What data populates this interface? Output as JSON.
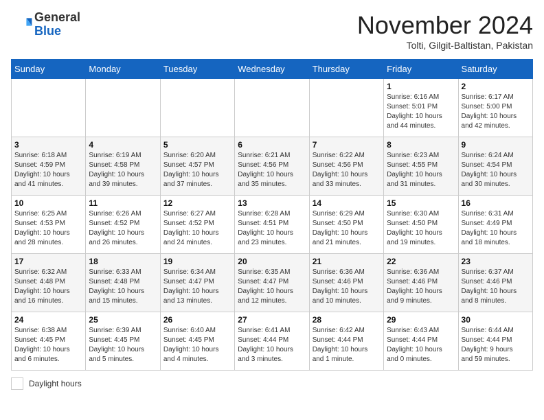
{
  "header": {
    "logo_general": "General",
    "logo_blue": "Blue",
    "month_title": "November 2024",
    "location": "Tolti, Gilgit-Baltistan, Pakistan"
  },
  "days_of_week": [
    "Sunday",
    "Monday",
    "Tuesday",
    "Wednesday",
    "Thursday",
    "Friday",
    "Saturday"
  ],
  "weeks": [
    [
      {
        "day": "",
        "info": ""
      },
      {
        "day": "",
        "info": ""
      },
      {
        "day": "",
        "info": ""
      },
      {
        "day": "",
        "info": ""
      },
      {
        "day": "",
        "info": ""
      },
      {
        "day": "1",
        "info": "Sunrise: 6:16 AM\nSunset: 5:01 PM\nDaylight: 10 hours\nand 44 minutes."
      },
      {
        "day": "2",
        "info": "Sunrise: 6:17 AM\nSunset: 5:00 PM\nDaylight: 10 hours\nand 42 minutes."
      }
    ],
    [
      {
        "day": "3",
        "info": "Sunrise: 6:18 AM\nSunset: 4:59 PM\nDaylight: 10 hours\nand 41 minutes."
      },
      {
        "day": "4",
        "info": "Sunrise: 6:19 AM\nSunset: 4:58 PM\nDaylight: 10 hours\nand 39 minutes."
      },
      {
        "day": "5",
        "info": "Sunrise: 6:20 AM\nSunset: 4:57 PM\nDaylight: 10 hours\nand 37 minutes."
      },
      {
        "day": "6",
        "info": "Sunrise: 6:21 AM\nSunset: 4:56 PM\nDaylight: 10 hours\nand 35 minutes."
      },
      {
        "day": "7",
        "info": "Sunrise: 6:22 AM\nSunset: 4:56 PM\nDaylight: 10 hours\nand 33 minutes."
      },
      {
        "day": "8",
        "info": "Sunrise: 6:23 AM\nSunset: 4:55 PM\nDaylight: 10 hours\nand 31 minutes."
      },
      {
        "day": "9",
        "info": "Sunrise: 6:24 AM\nSunset: 4:54 PM\nDaylight: 10 hours\nand 30 minutes."
      }
    ],
    [
      {
        "day": "10",
        "info": "Sunrise: 6:25 AM\nSunset: 4:53 PM\nDaylight: 10 hours\nand 28 minutes."
      },
      {
        "day": "11",
        "info": "Sunrise: 6:26 AM\nSunset: 4:52 PM\nDaylight: 10 hours\nand 26 minutes."
      },
      {
        "day": "12",
        "info": "Sunrise: 6:27 AM\nSunset: 4:52 PM\nDaylight: 10 hours\nand 24 minutes."
      },
      {
        "day": "13",
        "info": "Sunrise: 6:28 AM\nSunset: 4:51 PM\nDaylight: 10 hours\nand 23 minutes."
      },
      {
        "day": "14",
        "info": "Sunrise: 6:29 AM\nSunset: 4:50 PM\nDaylight: 10 hours\nand 21 minutes."
      },
      {
        "day": "15",
        "info": "Sunrise: 6:30 AM\nSunset: 4:50 PM\nDaylight: 10 hours\nand 19 minutes."
      },
      {
        "day": "16",
        "info": "Sunrise: 6:31 AM\nSunset: 4:49 PM\nDaylight: 10 hours\nand 18 minutes."
      }
    ],
    [
      {
        "day": "17",
        "info": "Sunrise: 6:32 AM\nSunset: 4:48 PM\nDaylight: 10 hours\nand 16 minutes."
      },
      {
        "day": "18",
        "info": "Sunrise: 6:33 AM\nSunset: 4:48 PM\nDaylight: 10 hours\nand 15 minutes."
      },
      {
        "day": "19",
        "info": "Sunrise: 6:34 AM\nSunset: 4:47 PM\nDaylight: 10 hours\nand 13 minutes."
      },
      {
        "day": "20",
        "info": "Sunrise: 6:35 AM\nSunset: 4:47 PM\nDaylight: 10 hours\nand 12 minutes."
      },
      {
        "day": "21",
        "info": "Sunrise: 6:36 AM\nSunset: 4:46 PM\nDaylight: 10 hours\nand 10 minutes."
      },
      {
        "day": "22",
        "info": "Sunrise: 6:36 AM\nSunset: 4:46 PM\nDaylight: 10 hours\nand 9 minutes."
      },
      {
        "day": "23",
        "info": "Sunrise: 6:37 AM\nSunset: 4:46 PM\nDaylight: 10 hours\nand 8 minutes."
      }
    ],
    [
      {
        "day": "24",
        "info": "Sunrise: 6:38 AM\nSunset: 4:45 PM\nDaylight: 10 hours\nand 6 minutes."
      },
      {
        "day": "25",
        "info": "Sunrise: 6:39 AM\nSunset: 4:45 PM\nDaylight: 10 hours\nand 5 minutes."
      },
      {
        "day": "26",
        "info": "Sunrise: 6:40 AM\nSunset: 4:45 PM\nDaylight: 10 hours\nand 4 minutes."
      },
      {
        "day": "27",
        "info": "Sunrise: 6:41 AM\nSunset: 4:44 PM\nDaylight: 10 hours\nand 3 minutes."
      },
      {
        "day": "28",
        "info": "Sunrise: 6:42 AM\nSunset: 4:44 PM\nDaylight: 10 hours\nand 1 minute."
      },
      {
        "day": "29",
        "info": "Sunrise: 6:43 AM\nSunset: 4:44 PM\nDaylight: 10 hours\nand 0 minutes."
      },
      {
        "day": "30",
        "info": "Sunrise: 6:44 AM\nSunset: 4:44 PM\nDaylight: 9 hours\nand 59 minutes."
      }
    ]
  ],
  "footer": {
    "legend_label": "Daylight hours"
  }
}
